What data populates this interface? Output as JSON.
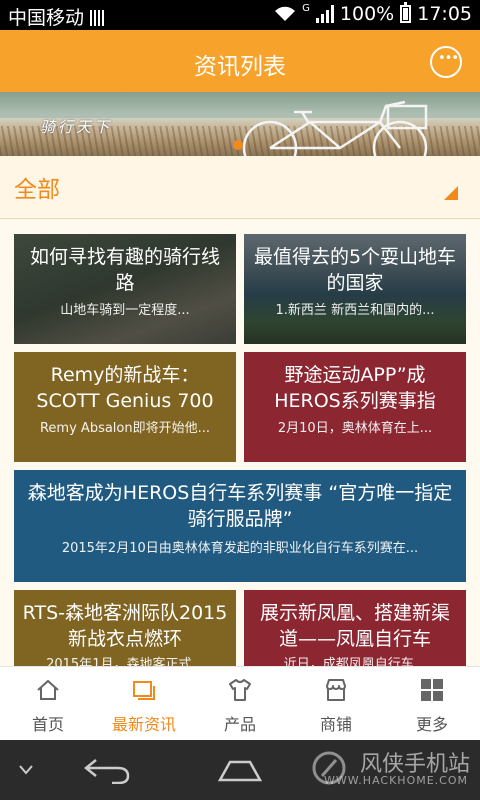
{
  "status_bar": {
    "carrier": "中国移动",
    "network_type": "G",
    "battery": "100%",
    "time": "17:05"
  },
  "header": {
    "title": "资讯列表"
  },
  "banner": {
    "caption": "骑行天下"
  },
  "category": {
    "label": "全部"
  },
  "cards": [
    {
      "title": "如何寻找有趣的骑行线路",
      "summary": "山地车骑到一定程度..."
    },
    {
      "title": "最值得去的5个耍山地车的国家",
      "summary": "1.新西兰 新西兰和国内的..."
    },
    {
      "title": "Remy的新战车：SCOTT Genius 700",
      "summary": "Remy Absalon即将开始他..."
    },
    {
      "title": "野途运动APP”成HEROS系列赛事指",
      "summary": "2月10日，奥林体育在上..."
    },
    {
      "title": "森地客成为HEROS自行车系列赛事 “官方唯一指定骑行服品牌”",
      "summary": "2015年2月10日由奥林体育发起的非职业化自行车系列赛在..."
    },
    {
      "title": "RTS-森地客洲际队2015新战衣点燃环",
      "summary": "2015年1月，森地客正式..."
    },
    {
      "title": "展示新凤凰、搭建新渠道——凤凰自行车",
      "summary": "近日，成都凤凰自行车..."
    }
  ],
  "bottom_nav": [
    {
      "label": "首页",
      "icon": "home-icon"
    },
    {
      "label": "最新资讯",
      "icon": "news-icon",
      "active": true
    },
    {
      "label": "产品",
      "icon": "shirt-icon"
    },
    {
      "label": "商铺",
      "icon": "shop-icon"
    },
    {
      "label": "更多",
      "icon": "grid-icon"
    }
  ],
  "watermark": {
    "text": "风侠手机站",
    "url": "WWW.HACKHOME.COM"
  },
  "colors": {
    "accent": "#f7a22a",
    "category": "#f08a1c",
    "olive": "#806421",
    "red": "#8c2732",
    "blue": "#215a80"
  }
}
